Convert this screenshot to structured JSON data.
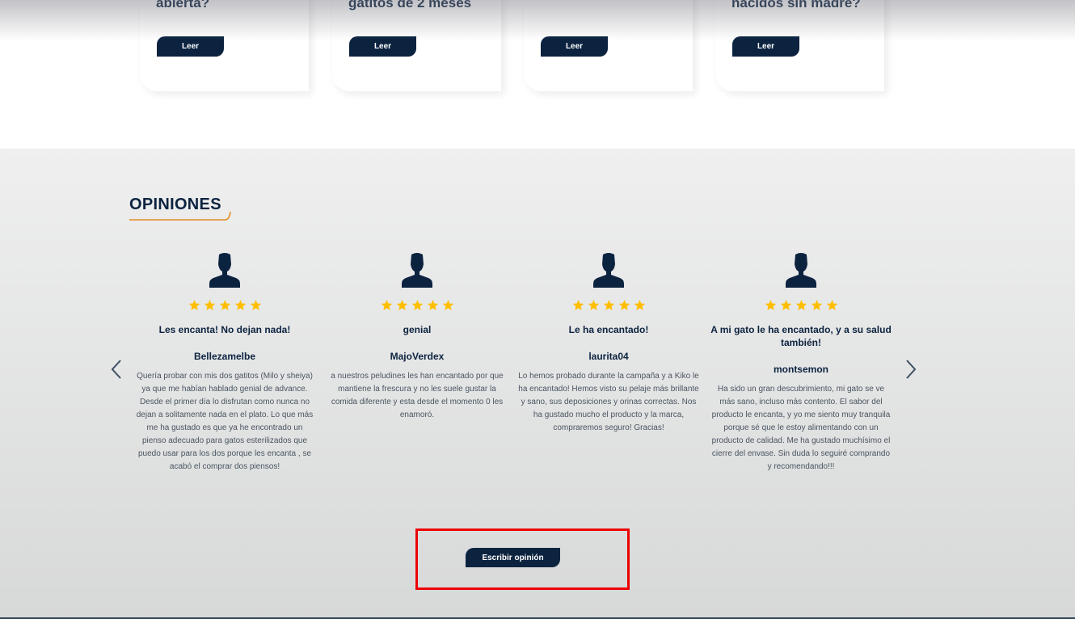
{
  "articles": [
    {
      "title": "abierta?",
      "button": "Leer"
    },
    {
      "title": "gatitos de 2 meses",
      "button": "Leer"
    },
    {
      "title": "",
      "button": "Leer"
    },
    {
      "title": "nacidos sin madre?",
      "button": "Leer"
    }
  ],
  "opinions": {
    "heading": "OPINIONES",
    "accent_color": "#e38b23",
    "star_color": "#ffbf00",
    "brand_color": "#0c2340",
    "prev_icon": "chevron-left-icon",
    "next_icon": "chevron-right-icon",
    "reviews": [
      {
        "rating": 5,
        "title": "Les encanta! No dejan nada!",
        "author": "Bellezamelbe",
        "text": "Quería probar con mis dos gatitos (Milo y sheiya) ya que me habían hablado genial de advance. Desde el primer día lo disfrutan como nunca no dejan a solitamente nada en el plato. Lo que más me ha gustado es que ya he encontrado un pienso adecuado para gatos esterilizados que puedo usar para los dos porque les encanta , se acabó el comprar dos piensos!"
      },
      {
        "rating": 5,
        "title": "genial",
        "author": "MajoVerdex",
        "text": "a nuestros peludines les han encantado por que mantiene la frescura y no les suele gustar la comida diferente y esta desde el momento 0 les enamoró."
      },
      {
        "rating": 5,
        "title": "Le ha encantado!",
        "author": "laurita04",
        "text": "Lo hemos probado durante la campaña y a Kiko le ha encantado! Hemos visto su pelaje más brillante y sano, sus deposiciones y orinas correctas. Nos ha gustado mucho el producto y la marca, compraremos seguro! Gracias!"
      },
      {
        "rating": 5,
        "title": "A mi gato le ha encantado, y a su salud también!",
        "author": "montsemon",
        "text": "Ha sido un gran descubrimiento, mi gato se ve más sano, incluso más contento. El sabor del producto le encanta, y yo me siento muy tranquila porque sé que le estoy alimentando con un producto de calidad. Me ha gustado muchísimo el cierre del envase. Sin duda lo seguiré comprando y recomendando!!!"
      }
    ],
    "write_button": "Escribir opinión"
  }
}
